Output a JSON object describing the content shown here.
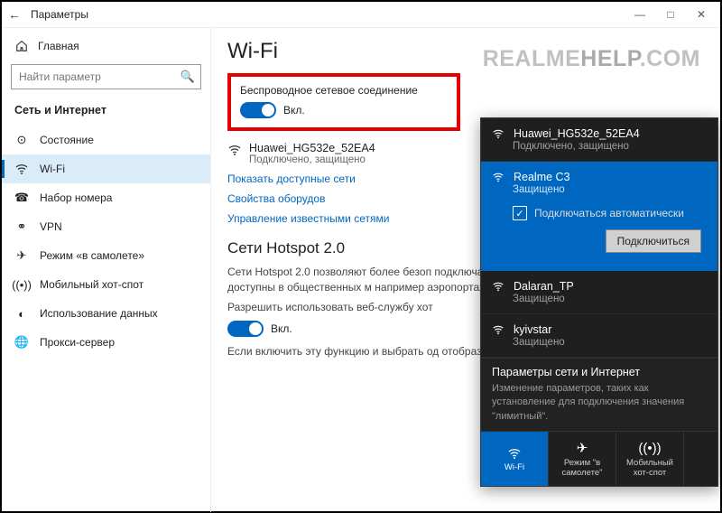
{
  "watermark": {
    "a": "REALME",
    "b": "HELP",
    "c": ".COM"
  },
  "titlebar": {
    "title": "Параметры"
  },
  "sidebar": {
    "home": "Главная",
    "search_placeholder": "Найти параметр",
    "category": "Сеть и Интернет",
    "items": [
      {
        "label": "Состояние"
      },
      {
        "label": "Wi-Fi"
      },
      {
        "label": "Набор номера"
      },
      {
        "label": "VPN"
      },
      {
        "label": "Режим «в самолете»"
      },
      {
        "label": "Мобильный хот-спот"
      },
      {
        "label": "Использование данных"
      },
      {
        "label": "Прокси-сервер"
      }
    ]
  },
  "main": {
    "heading": "Wi-Fi",
    "wireless_label": "Беспроводное сетевое соединение",
    "on_label": "Вкл.",
    "net": {
      "name": "Huawei_HG532e_52EA4",
      "status": "Подключено, защищено"
    },
    "link_show": "Показать доступные сети",
    "link_props": "Свойства оборудов",
    "link_manage": "Управление известными сетями",
    "hotspot_heading": "Сети Hotspot 2.0",
    "hotspot_desc": "Сети Hotspot 2.0 позволяют более безоп подключаться к общедоступным хот-спо могут быть доступны в общественных м например аэропортах, гостиницах и каф",
    "hotspot_allow": "Разрешить использовать веб-службу хот",
    "hotspot_desc2": "Если включить эту функцию и выбрать од отобразится список поставщиков для по Интернету."
  },
  "flyout": {
    "items": [
      {
        "name": "Huawei_HG532e_52EA4",
        "status": "Подключено, защищено"
      },
      {
        "name": "Realme C3",
        "status": "Защищено",
        "selected": true
      },
      {
        "name": "Dalaran_TP",
        "status": "Защищено"
      },
      {
        "name": "kyivstar",
        "status": "Защищено"
      }
    ],
    "auto_label": "Подключаться автоматически",
    "connect_btn": "Подключиться",
    "footer_title": "Параметры сети и Интернет",
    "footer_desc": "Изменение параметров, таких как установление для подключения значения \"лимитный\".",
    "tiles": [
      {
        "label": "Wi-Fi",
        "on": true
      },
      {
        "label": "Режим \"в самолете\""
      },
      {
        "label": "Мобильный хот-спот"
      }
    ]
  }
}
